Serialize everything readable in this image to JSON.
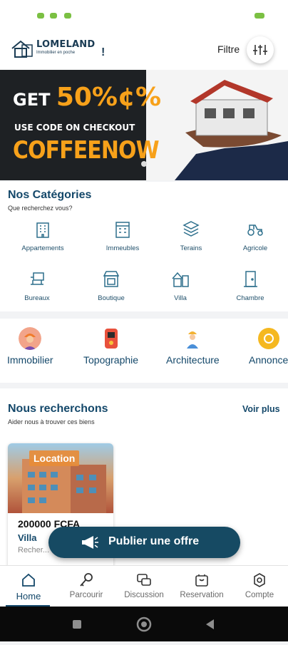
{
  "header": {
    "brand": "LOMELAND",
    "tagline": "Immobilier en poche",
    "filter_label": "Filtre",
    "filter_icon": "sliders-icon"
  },
  "banner": {
    "headline_prefix": "GET",
    "headline_value": "50%¢%",
    "line": "USE CODE ON CHECKOUT",
    "code": "COFFEENOW"
  },
  "categories": {
    "title": "Nos Catégories",
    "subtitle": "Que recherchez vous?",
    "items": [
      {
        "label": "Appartements",
        "icon": "apartment-icon"
      },
      {
        "label": "Immeubles",
        "icon": "building-icon"
      },
      {
        "label": "Terains",
        "icon": "land-icon"
      },
      {
        "label": "Agricole",
        "icon": "tractor-icon"
      },
      {
        "label": "Bureaux",
        "icon": "office-icon"
      },
      {
        "label": "Boutique",
        "icon": "shop-icon"
      },
      {
        "label": "Villa",
        "icon": "villa-icon"
      },
      {
        "label": "Chambre",
        "icon": "door-icon"
      }
    ]
  },
  "services": [
    {
      "label": "Immobilier",
      "icon": "worker-icon"
    },
    {
      "label": "Topographie",
      "icon": "meter-icon"
    },
    {
      "label": "Architecture",
      "icon": "architect-icon"
    },
    {
      "label": "Annonce",
      "icon": "badge-icon"
    }
  ],
  "search": {
    "title": "Nous recherchons",
    "subtitle": "Aider nous à trouver ces biens",
    "see_more": "Voir plus",
    "card": {
      "badge": "Location",
      "price": "200000 FCFA",
      "type": "Villa",
      "description": "Recher... a acheter"
    }
  },
  "publish": {
    "label": "Publier une offre",
    "icon": "megaphone-icon"
  },
  "nav": [
    {
      "label": "Home",
      "icon": "home-icon",
      "active": true
    },
    {
      "label": "Parcourir",
      "icon": "search-key-icon"
    },
    {
      "label": "Discussion",
      "icon": "chat-icon"
    },
    {
      "label": "Reservation",
      "icon": "calendar-bag-icon"
    },
    {
      "label": "Compte",
      "icon": "settings-icon"
    }
  ],
  "colors": {
    "primary": "#14486a",
    "accent": "#f7a11a"
  }
}
